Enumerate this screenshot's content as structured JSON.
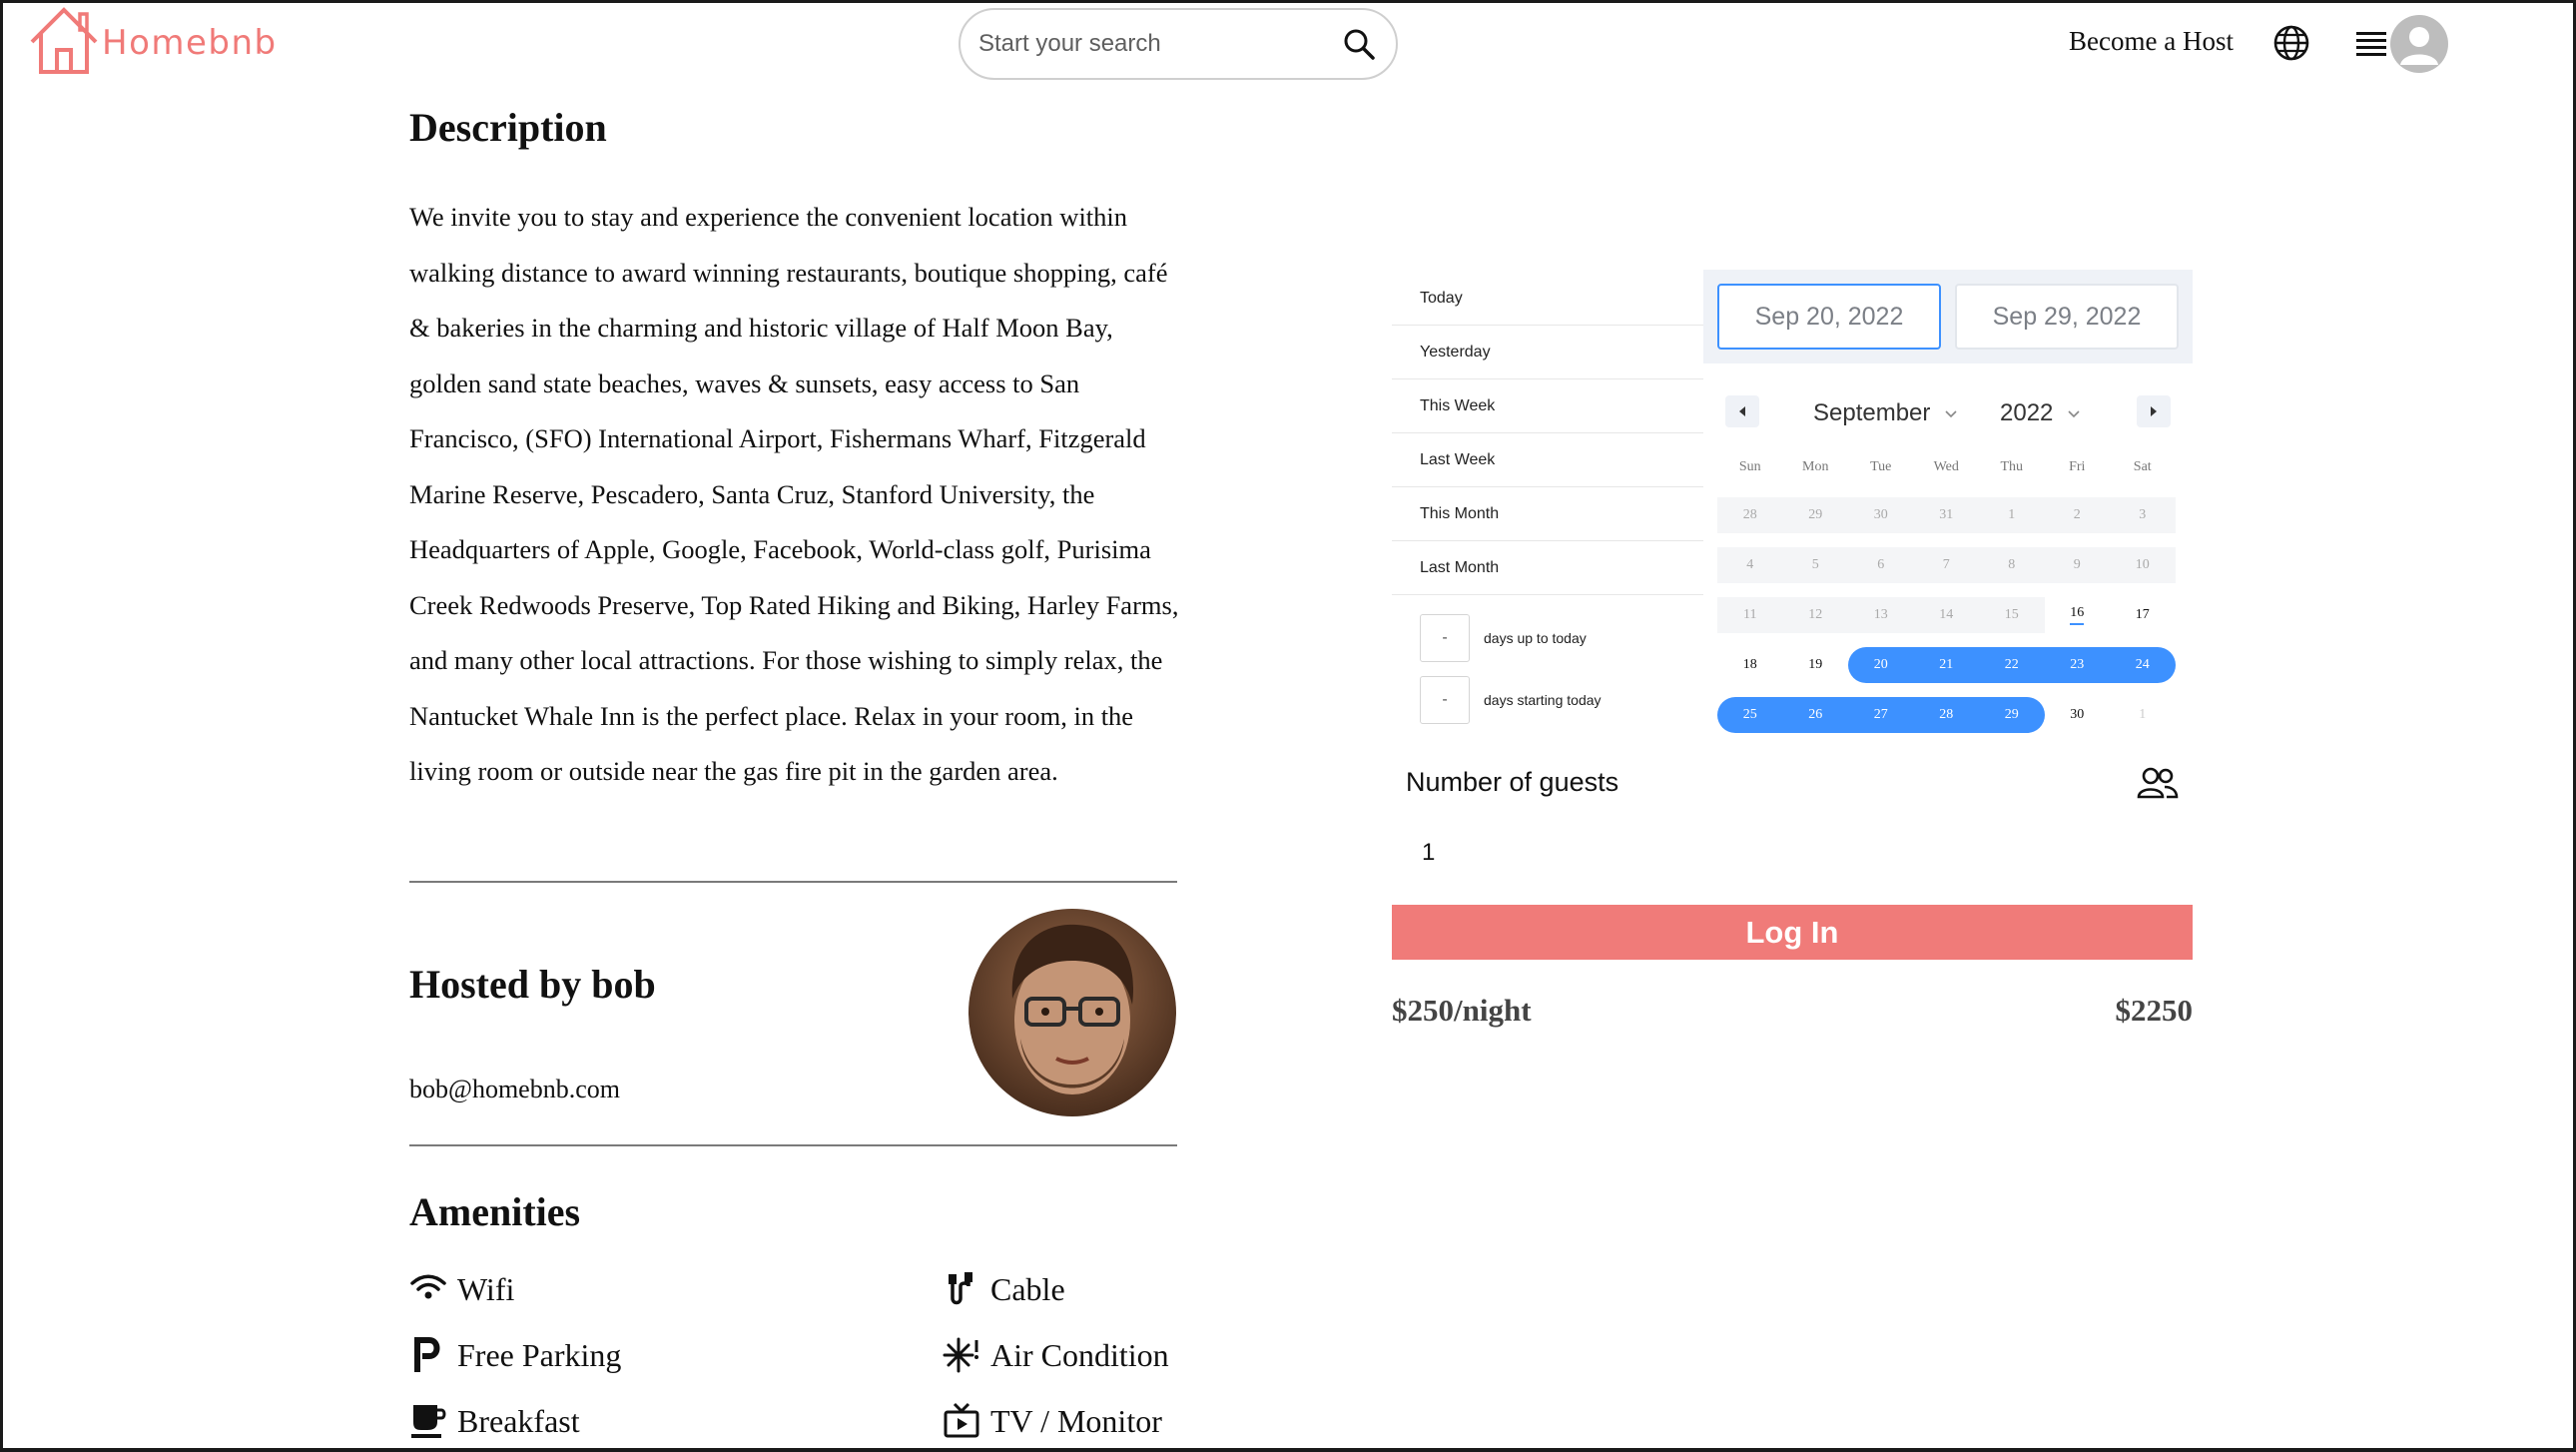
{
  "header": {
    "logo_text": "Homebnb",
    "search_placeholder": "Start your search",
    "become_host": "Become a Host",
    "brand_color": "#f07a78"
  },
  "listing": {
    "description_title": "Description",
    "description": "We invite you to stay and experience the convenient location within walking distance to award winning restaurants, boutique shopping, café & bakeries in the charming and historic village of Half Moon Bay, golden sand state beaches, waves & sunsets, easy access to San Francisco, (SFO) International Airport, Fishermans Wharf, Fitzgerald Marine Reserve, Pescadero, Santa Cruz, Stanford University, the Headquarters of Apple, Google, Facebook, World-class golf, Purisima Creek Redwoods Preserve, Top Rated Hiking and Biking, Harley Farms, and many other local attractions. For those wishing to simply relax, the Nantucket Whale Inn is the perfect place. Relax in your room, in the living room or outside near the gas fire pit in the garden area.",
    "host_title": "Hosted by bob",
    "host_email": "bob@homebnb.com",
    "amenities_title": "Amenities",
    "amenities": [
      {
        "label": "Wifi",
        "icon": "wifi-icon"
      },
      {
        "label": "Cable",
        "icon": "cable-icon"
      },
      {
        "label": "Free Parking",
        "icon": "parking-icon"
      },
      {
        "label": "Air Condition",
        "icon": "snowflake-icon"
      },
      {
        "label": "Breakfast",
        "icon": "coffee-icon"
      },
      {
        "label": "TV / Monitor",
        "icon": "tv-icon"
      }
    ]
  },
  "booking": {
    "static_ranges": [
      "Today",
      "Yesterday",
      "This Week",
      "Last Week",
      "This Month",
      "Last Month"
    ],
    "input_ranges": [
      {
        "value": "-",
        "label": "days up to today"
      },
      {
        "value": "-",
        "label": "days starting today"
      }
    ],
    "start_date": "Sep 20, 2022",
    "end_date": "Sep 29, 2022",
    "month": "September",
    "year": "2022",
    "weekdays": [
      "Sun",
      "Mon",
      "Tue",
      "Wed",
      "Thu",
      "Fri",
      "Sat"
    ],
    "days": [
      {
        "d": "28",
        "s": "passive"
      },
      {
        "d": "29",
        "s": "passive"
      },
      {
        "d": "30",
        "s": "passive"
      },
      {
        "d": "31",
        "s": "passive"
      },
      {
        "d": "1",
        "s": "passive"
      },
      {
        "d": "2",
        "s": "passive"
      },
      {
        "d": "3",
        "s": "passive"
      },
      {
        "d": "4",
        "s": "passive"
      },
      {
        "d": "5",
        "s": "passive"
      },
      {
        "d": "6",
        "s": "passive"
      },
      {
        "d": "7",
        "s": "passive"
      },
      {
        "d": "8",
        "s": "passive"
      },
      {
        "d": "9",
        "s": "passive"
      },
      {
        "d": "10",
        "s": "passive"
      },
      {
        "d": "11",
        "s": "passive"
      },
      {
        "d": "12",
        "s": "passive"
      },
      {
        "d": "13",
        "s": "passive"
      },
      {
        "d": "14",
        "s": "passive"
      },
      {
        "d": "15",
        "s": "passive"
      },
      {
        "d": "16",
        "s": "today"
      },
      {
        "d": "17",
        "s": ""
      },
      {
        "d": "18",
        "s": ""
      },
      {
        "d": "19",
        "s": ""
      },
      {
        "d": "20",
        "s": "start"
      },
      {
        "d": "21",
        "s": "sel"
      },
      {
        "d": "22",
        "s": "sel"
      },
      {
        "d": "23",
        "s": "sel"
      },
      {
        "d": "24",
        "s": "end"
      },
      {
        "d": "25",
        "s": "start"
      },
      {
        "d": "26",
        "s": "sel"
      },
      {
        "d": "27",
        "s": "sel"
      },
      {
        "d": "28",
        "s": "sel"
      },
      {
        "d": "29",
        "s": "end"
      },
      {
        "d": "30",
        "s": ""
      },
      {
        "d": "1",
        "s": "outside"
      }
    ],
    "selection_color": "#3d91ff",
    "guests_label": "Number of guests",
    "guests_value": "1",
    "login_label": "Log In",
    "price_per_night": "$250/night",
    "price_total": "$2250",
    "button_color": "#f07b79"
  }
}
